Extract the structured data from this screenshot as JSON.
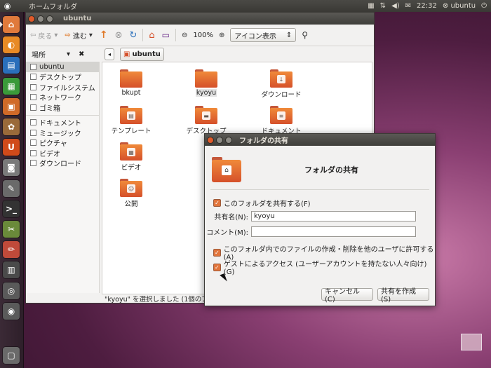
{
  "top_panel": {
    "app_title": "ホームフォルダ",
    "time": "22:32",
    "user": "ubuntu"
  },
  "launcher": {
    "items": [
      {
        "name": "home-folder",
        "color": "#e07a3c"
      },
      {
        "name": "firefox",
        "color": "#e88a25"
      },
      {
        "name": "writer",
        "color": "#2a6fbb"
      },
      {
        "name": "calc",
        "color": "#3a9a3a"
      },
      {
        "name": "impress",
        "color": "#d06a28"
      },
      {
        "name": "software-center",
        "color": "#9a6a3a"
      },
      {
        "name": "ubuntu-one",
        "color": "#d04a1a"
      },
      {
        "name": "shotwell",
        "color": "#7a7a7a"
      },
      {
        "name": "text-editor",
        "color": "#6a6a6a"
      },
      {
        "name": "terminal",
        "color": "#333333"
      },
      {
        "name": "settings",
        "color": "#6a8a3a"
      },
      {
        "name": "pencils",
        "color": "#c04a3a"
      },
      {
        "name": "system-monitor",
        "color": "#4a4a4a"
      },
      {
        "name": "applications",
        "color": "#5a5a5a"
      },
      {
        "name": "files",
        "color": "#5a5a5a"
      },
      {
        "name": "trash",
        "color": "#6a6a6a"
      }
    ]
  },
  "nautilus": {
    "window_title": "ubuntu",
    "toolbar": {
      "back": "戻る",
      "forward": "進む",
      "zoom": "100%",
      "view_mode": "アイコン表示"
    },
    "sidebar": {
      "header": "場所",
      "places": [
        "ubuntu",
        "デスクトップ",
        "ファイルシステム",
        "ネットワーク",
        "ゴミ箱"
      ],
      "bookmarks": [
        "ドキュメント",
        "ミュージック",
        "ピクチャ",
        "ビデオ",
        "ダウンロード"
      ]
    },
    "breadcrumb": "ubuntu",
    "files": [
      {
        "label": "bkupt",
        "emblem": ""
      },
      {
        "label": "kyoyu",
        "emblem": ""
      },
      {
        "label": "ダウンロード",
        "emblem": "↓"
      },
      {
        "label": "テンプレート",
        "emblem": "▤"
      },
      {
        "label": "デスクトップ",
        "emblem": "▬"
      },
      {
        "label": "ドキュメント",
        "emblem": "≡"
      },
      {
        "label": "ビデオ",
        "emblem": "▦"
      },
      {
        "label": "公開",
        "emblem": "☺"
      }
    ],
    "status": "\"kyoyu\" を選択しました (1個のア"
  },
  "dialog": {
    "title": "フォルダの共有",
    "heading": "フォルダの共有",
    "share_checkbox": "このフォルダを共有する(F)",
    "share_name_label": "共有名(N):",
    "share_name_value": "kyoyu",
    "comment_label": "コメント(M):",
    "comment_value": "",
    "allow_others_checkbox": "このフォルダ内でのファイルの作成・削除を他のユーザに許可する(A)",
    "guest_checkbox": "ゲストによるアクセス (ユーザーアカウントを持たない人々向け) (G)",
    "cancel_button": "キャンセル(C)",
    "create_button": "共有を作成(S)"
  }
}
